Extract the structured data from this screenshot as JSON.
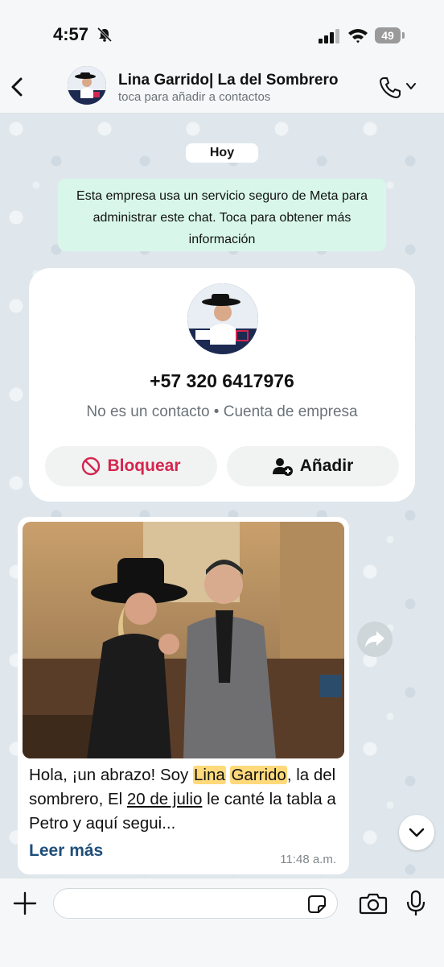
{
  "status_bar": {
    "time": "4:57",
    "battery": "49"
  },
  "header": {
    "contact_name": "Lina Garrido| La del Sombrero",
    "subtitle": "toca para añadir a contactos"
  },
  "chat": {
    "date_label": "Hoy",
    "secure_notice": "Esta empresa usa un servicio seguro de Meta para administrar este chat. Toca para obtener más información"
  },
  "contact_card": {
    "phone": "+57 320 6417976",
    "info": "No es un contacto • Cuenta de empresa",
    "block_label": "Bloquear",
    "add_label": "Añadir"
  },
  "message": {
    "text_1": "Hola, ¡un abrazo! Soy ",
    "hl_1": "Lina",
    "text_2": " ",
    "hl_2": "Garrido",
    "text_3": ", la del sombrero, El ",
    "ul_1": "20 de julio",
    "text_4": " le canté la tabla a Petro y aquí segui...",
    "read_more": "Leer más",
    "time": "11:48 a.m."
  },
  "input_bar": {
    "placeholder": ""
  },
  "colors": {
    "accent_red": "#d3254e",
    "notice_green": "#d8f7ea",
    "link_blue": "#1f4f7a",
    "highlight": "#ffd97a"
  },
  "icons": [
    "bell-mute-icon",
    "signal-icon",
    "wifi-icon",
    "battery-icon",
    "back-icon",
    "phone-icon",
    "chevron-down-icon",
    "block-icon",
    "add-contact-icon",
    "forward-icon",
    "scroll-down-icon",
    "plus-icon",
    "sticker-icon",
    "camera-icon",
    "mic-icon"
  ]
}
